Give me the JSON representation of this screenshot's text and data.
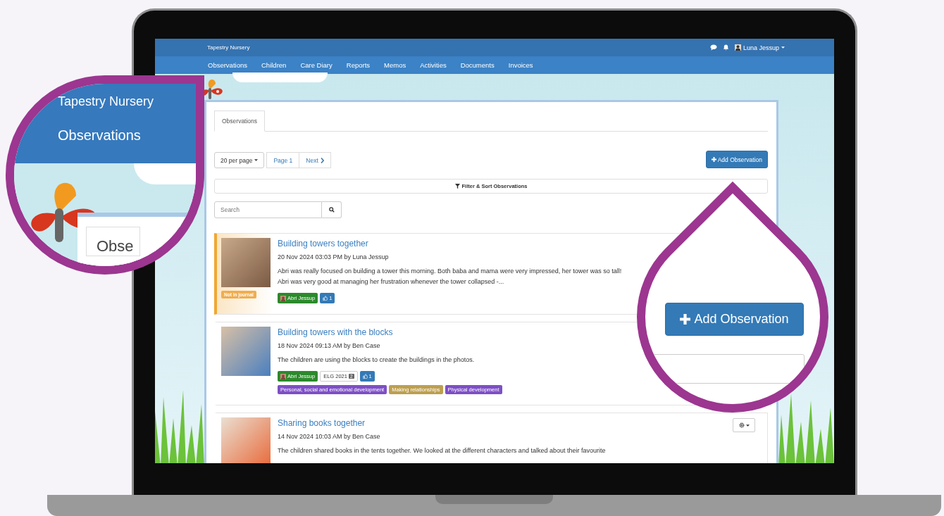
{
  "header": {
    "brand": "Tapestry Nursery",
    "user": "Luna Jessup"
  },
  "nav": [
    "Observations",
    "Children",
    "Care Diary",
    "Reports",
    "Memos",
    "Activities",
    "Documents",
    "Invoices"
  ],
  "tabs": [
    {
      "label": "Observations",
      "selected": true
    }
  ],
  "per_page": "20 per page",
  "pagination": [
    {
      "kind": "page",
      "label": "Page 1"
    },
    {
      "kind": "next",
      "label": "Next"
    }
  ],
  "add_button": "Add Observation",
  "filter_button": "Filter & Sort Observations",
  "search": {
    "placeholder": "Search"
  },
  "observations": [
    {
      "title": "Building towers together",
      "meta": "20 Nov 2024 03:03 PM by Luna Jessup",
      "text": "Abri was really focused on building a tower this morning. Both baba and mama were very impressed, her tower was so tall! Abri was very good at managing her frustration whenever the tower collapsed -...",
      "status_badge": "Not in journal",
      "tags": [
        {
          "kind": "child",
          "label": "Abri Jessup"
        },
        {
          "kind": "likes",
          "label": "1"
        }
      ]
    },
    {
      "title": "Building towers with the blocks",
      "meta": "18 Nov 2024 09:13 AM by Ben Case",
      "text": "The children are using the blocks to create the buildings in the photos.",
      "tags": [
        {
          "kind": "child",
          "label": "Abri Jessup"
        },
        {
          "kind": "framework",
          "label": "ELG 2021",
          "count": "2"
        },
        {
          "kind": "likes",
          "label": "1"
        }
      ],
      "areas": [
        {
          "label": "Personal, social and emotional development",
          "color": "#7e4fc6"
        },
        {
          "label": "Making relationships",
          "color": "#bd9f4f"
        },
        {
          "label": "Physical development",
          "color": "#7e4fc6"
        }
      ]
    },
    {
      "title": "Sharing books together",
      "meta": "14 Nov 2024 10:03 AM by Ben Case",
      "text": "The children shared books in the tents together. We looked at the different characters and talked about their favourite",
      "settings_menu": true
    }
  ],
  "callouts": [
    {
      "kind": "header_zoom",
      "brand": "Tapestry Nursery",
      "nav_item": "Observations",
      "tab_label": "Obse"
    },
    {
      "kind": "button_zoom",
      "button": "Add Observation"
    }
  ]
}
